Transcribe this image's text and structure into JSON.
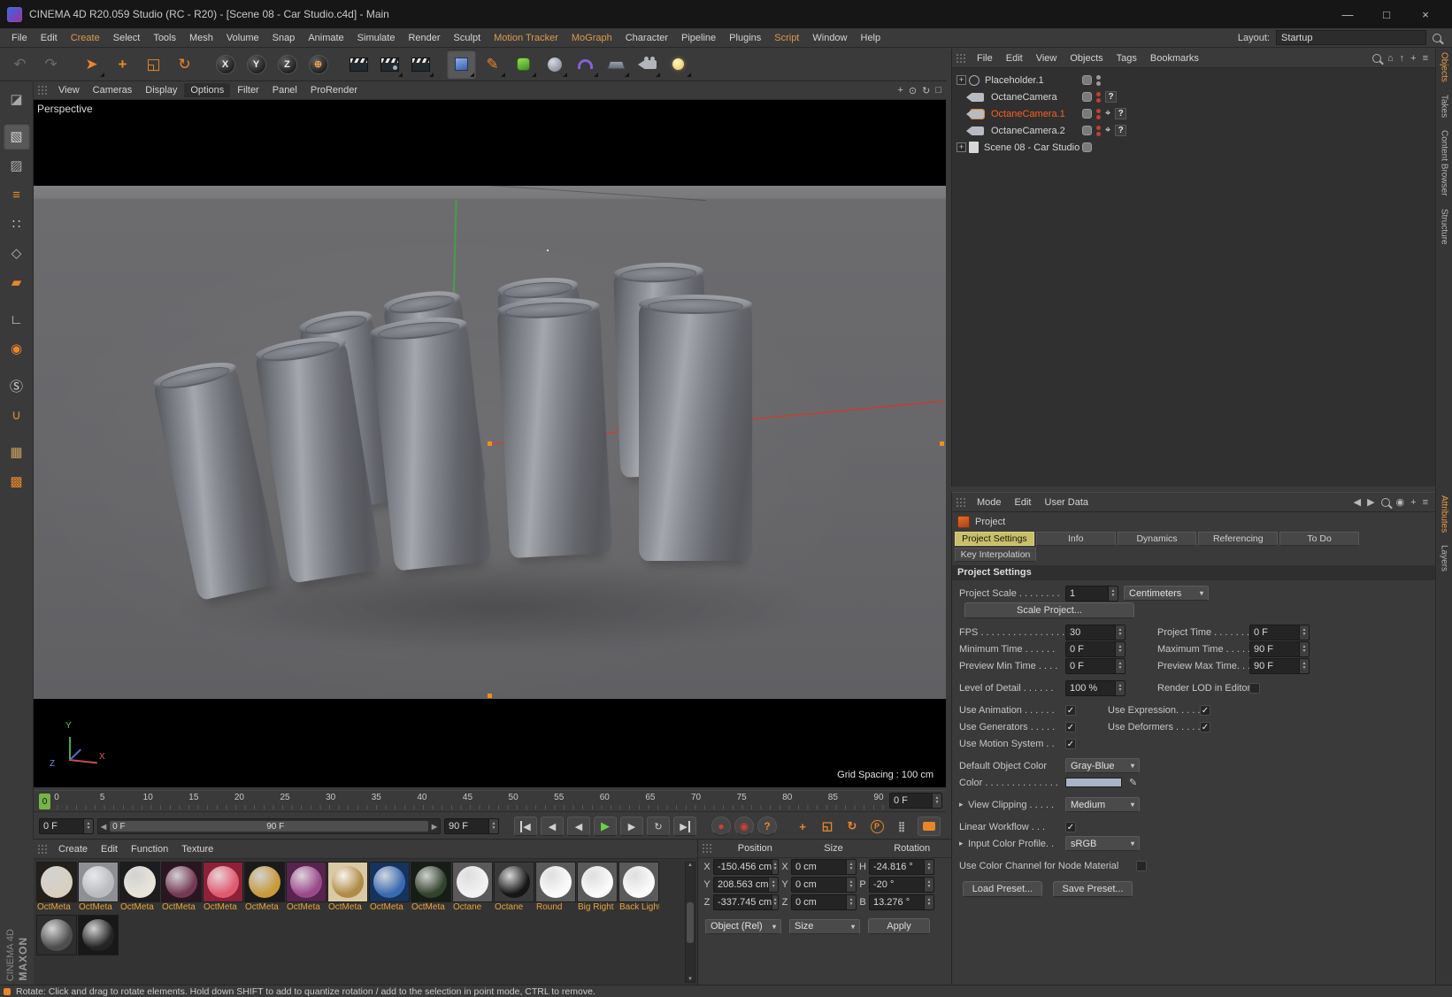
{
  "colors": {
    "accent_orange": "#e8872a",
    "selected_text": "#ff5f1f",
    "active_tab_bg": "#c9bf6b",
    "play_green": "#6ad04a",
    "swatch_blue_gray": "#a9b4c6"
  },
  "icons": {
    "minimize": "—",
    "maximize": "□",
    "close": "×",
    "undo": "↶",
    "redo": "↷",
    "select": "➤",
    "move": "+",
    "scale": "◱",
    "rotate": "↻",
    "axis_x": "X",
    "axis_y": "Y",
    "axis_z": "Z",
    "coord": "⊕",
    "pen": "✎",
    "goto_start": "◀",
    "prev_key": "◀",
    "prev_frame": "◀",
    "play": "▶",
    "next_frame": "▶",
    "loop": "↻",
    "goto_end": "▶",
    "record": "●",
    "autokey": "◉",
    "question": "?",
    "rec_pos": "+",
    "rec_scale": "◱",
    "rec_rot": "↻",
    "rec_param": "P",
    "rec_pla": "⣿",
    "caret": "▾",
    "spin_up": "▲",
    "spin_down": "▼",
    "check": "✓",
    "twist": "▸",
    "expander_plus": "+",
    "target": "⌖",
    "pan_view": "+",
    "dolly_view": "⊙",
    "rotate_view": "↻",
    "toggle_view": "□",
    "home": "⌂",
    "up": "↑",
    "plus": "+",
    "burger": "≡",
    "slider_left": "◀",
    "slider_right": "▶",
    "prev": "◀",
    "next": "▶",
    "lockdot": "◉"
  },
  "title_bar": {
    "title": "CINEMA 4D R20.059 Studio (RC - R20) - [Scene 08 - Car Studio.c4d] - Main"
  },
  "menu_bar": {
    "items": [
      "File",
      "Edit",
      "Create",
      "Select",
      "Tools",
      "Mesh",
      "Volume",
      "Snap",
      "Animate",
      "Simulate",
      "Render",
      "Sculpt",
      "Motion Tracker",
      "MoGraph",
      "Character",
      "Pipeline",
      "Plugins",
      "Script",
      "Window",
      "Help"
    ],
    "highlight_items": [
      "Create",
      "Motion Tracker",
      "MoGraph",
      "Script"
    ],
    "layout_label": "Layout:",
    "layout_value": "Startup"
  },
  "viewport": {
    "menu_items": [
      "View",
      "Cameras",
      "Display",
      "Options",
      "Filter",
      "Panel",
      "ProRender"
    ],
    "active_menu": "Options",
    "camera_label": "Perspective",
    "grid_spacing": "Grid Spacing : 100 cm",
    "axis_x": "X",
    "axis_y": "Y",
    "axis_z": "Z"
  },
  "left_toolbar": {
    "items": [
      {
        "name": "make-editable-button",
        "glyph": "◪",
        "color": "#a8a8a8"
      },
      {
        "name": "model-mode-button",
        "glyph": "▧",
        "color": "#d0d0d0",
        "active": true,
        "gap": true
      },
      {
        "name": "texture-mode-button",
        "glyph": "▨",
        "color": "#a8a8a8"
      },
      {
        "name": "workplane-mode-button",
        "glyph": "≡",
        "color": "#e8872a"
      },
      {
        "name": "points-mode-button",
        "glyph": "∷",
        "color": "#b8b8b8"
      },
      {
        "name": "edges-mode-button",
        "glyph": "◇",
        "color": "#b8b8b8"
      },
      {
        "name": "polygons-mode-button",
        "glyph": "▰",
        "color": "#e8872a"
      },
      {
        "name": "axis-mode-button",
        "glyph": "∟",
        "color": "#d8d8d8",
        "gap": true
      },
      {
        "name": "viewport-solo-button",
        "glyph": "◉",
        "color": "#e8872a"
      },
      {
        "name": "enable-snap-button",
        "glyph": "Ⓢ",
        "color": "#d8d8d8",
        "gap": true
      },
      {
        "name": "magnet-tool-button",
        "glyph": "∪",
        "color": "#e8872a"
      },
      {
        "name": "workplane-button",
        "glyph": "▦",
        "color": "#c8a060",
        "gap": true
      },
      {
        "name": "lock-workplane-button",
        "glyph": "▩",
        "color": "#e8872a"
      }
    ]
  },
  "object_manager": {
    "menus": [
      "File",
      "Edit",
      "View",
      "Objects",
      "Tags",
      "Bookmarks"
    ],
    "objects": [
      {
        "name": "Placeholder.1",
        "icon": "null",
        "expander": true,
        "toggle": true,
        "dots": "gray"
      },
      {
        "name": "OctaneCamera",
        "icon": "camera",
        "toggle": true,
        "dots": "red",
        "tag": "?"
      },
      {
        "name": "OctaneCamera.1",
        "icon": "camera",
        "selected": true,
        "toggle": true,
        "dots": "red",
        "target": true,
        "tag": "?"
      },
      {
        "name": "OctaneCamera.2",
        "icon": "camera",
        "toggle": true,
        "dots": "red",
        "target": true,
        "tag": "?"
      },
      {
        "name": "Scene 08 - Car Studio",
        "icon": "scene",
        "expander": true,
        "toggle": true
      }
    ]
  },
  "attributes": {
    "menus": [
      "Mode",
      "Edit",
      "User Data"
    ],
    "object_label": "Project",
    "tabs": [
      "Project Settings",
      "Info",
      "Dynamics",
      "Referencing",
      "To Do"
    ],
    "tabs2": [
      "Key Interpolation"
    ],
    "active_tab": "Project Settings",
    "section_title": "Project Settings",
    "fields": {
      "project_scale_label": "Project Scale . . . . . . . .",
      "project_scale_value": "1",
      "project_scale_unit": "Centimeters",
      "scale_project_button": "Scale Project...",
      "fps_label": "FPS . . . . . . . . . . . . . . . .",
      "fps_value": "30",
      "project_time_label": "Project Time . . . . . . . .",
      "project_time_value": "0 F",
      "minimum_time_label": "Minimum Time . . . . . .",
      "minimum_time_value": "0 F",
      "maximum_time_label": "Maximum Time . . . . . .",
      "maximum_time_value": "90 F",
      "preview_min_label": "Preview Min Time . . . .",
      "preview_min_value": "0 F",
      "preview_max_label": "Preview Max Time. . . .",
      "preview_max_value": "90 F",
      "lod_label": "Level of Detail . . . . . .",
      "lod_value": "100 %",
      "render_lod_label": "Render LOD in Editor",
      "use_animation_label": "Use Animation . . . . . .",
      "use_expression_label": "Use Expression. . . . . .",
      "use_generators_label": "Use Generators . . . . .",
      "use_deformers_label": "Use Deformers . . . . . .",
      "use_motion_label": "Use Motion System . .",
      "default_color_label": "Default Object Color",
      "default_color_value": "Gray-Blue",
      "color_label": "Color . . . . . . . . . . . . . .",
      "view_clipping_label": "View Clipping . . . . .",
      "view_clipping_value": "Medium",
      "linear_workflow_label": "Linear Workflow . . .",
      "input_profile_label": "Input Color Profile. .",
      "input_profile_value": "sRGB",
      "node_material_label": "Use Color Channel for Node Material",
      "load_preset_button": "Load Preset...",
      "save_preset_button": "Save Preset..."
    }
  },
  "timeline": {
    "ticks": [
      "0",
      "5",
      "10",
      "15",
      "20",
      "25",
      "30",
      "35",
      "40",
      "45",
      "50",
      "55",
      "60",
      "65",
      "70",
      "75",
      "80",
      "85",
      "90"
    ],
    "marker": "0",
    "current_frame": "0 F",
    "range_start": "0 F",
    "range_end": "90 F",
    "end_frame": "90 F"
  },
  "materials": {
    "menus": [
      "Create",
      "Edit",
      "Function",
      "Texture"
    ],
    "items": [
      {
        "label": "OctMeta",
        "bg": "#23201c",
        "ball": "#d8cfc0"
      },
      {
        "label": "OctMeta",
        "bg": "#8f9094",
        "ball": "#babbbf"
      },
      {
        "label": "OctMeta",
        "bg": "#1d1d20",
        "ball": "#e8e4da"
      },
      {
        "label": "OctMeta",
        "bg": "#2a1620",
        "ball": "#743a54"
      },
      {
        "label": "OctMeta",
        "bg": "#8c2138",
        "ball": "#e05a70"
      },
      {
        "label": "OctMeta",
        "bg": "#1a1a1a",
        "ball": "#c89a3a"
      },
      {
        "label": "OctMeta",
        "bg": "#56244e",
        "ball": "#9a4a8a"
      },
      {
        "label": "OctMeta",
        "bg": "#d9c9a4",
        "ball": "#b08a46"
      },
      {
        "label": "OctMeta",
        "bg": "#16335e",
        "ball": "#3a6ab0"
      },
      {
        "label": "OctMeta",
        "bg": "#151d16",
        "ball": "#32422e"
      },
      {
        "label": "Octane",
        "bg": "#5a5a5a",
        "ball": "#f2f2f2"
      },
      {
        "label": "Octane",
        "bg": "#3a3a3a",
        "ball": "#161616"
      },
      {
        "label": "Round",
        "bg": "#5a5a5a",
        "ball": "#fafafa"
      },
      {
        "label": "Big Right",
        "bg": "#5a5a5a",
        "ball": "#fafafa"
      },
      {
        "label": "Back Light",
        "bg": "#5a5a5a",
        "ball": "#fafafa"
      },
      {
        "label": "",
        "bg": "#2e2e2e",
        "ball": "#4e4e4e"
      },
      {
        "label": "",
        "bg": "#181818",
        "ball": "#242424"
      }
    ]
  },
  "coordinates": {
    "headers": [
      "Position",
      "Size",
      "Rotation"
    ],
    "rows": [
      {
        "axis": "X",
        "pos": "-150.456 cm",
        "size_axis": "X",
        "size": "0 cm",
        "rot_axis": "H",
        "rot": "-24.816 °"
      },
      {
        "axis": "Y",
        "pos": "208.563 cm",
        "size_axis": "Y",
        "size": "0 cm",
        "rot_axis": "P",
        "rot": "-20 °"
      },
      {
        "axis": "Z",
        "pos": "-337.745 cm",
        "size_axis": "Z",
        "size": "0 cm",
        "rot_axis": "B",
        "rot": "13.276 °"
      }
    ],
    "object_mode": "Object (Rel)",
    "size_mode": "Size",
    "apply_button": "Apply"
  },
  "side_tabs": {
    "top": [
      "Objects",
      "Takes",
      "Content Browser",
      "Structure"
    ],
    "bottom": [
      "Attributes",
      "Layers"
    ]
  },
  "brand": {
    "line1": "MAXON",
    "line2": "CINEMA 4D"
  },
  "status_bar": {
    "text": "Rotate: Click and drag to rotate elements. Hold down SHIFT to add to quantize rotation / add to the selection in point mode, CTRL to remove."
  }
}
